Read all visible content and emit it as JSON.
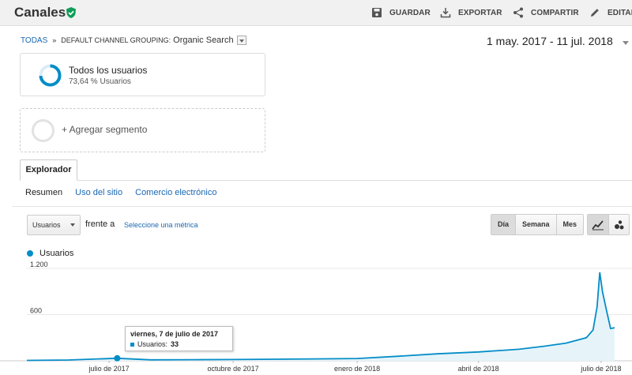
{
  "header": {
    "title": "Canales",
    "actions": [
      {
        "label": "GUARDAR",
        "icon": "save-icon"
      },
      {
        "label": "EXPORTAR",
        "icon": "export-icon"
      },
      {
        "label": "COMPARTIR",
        "icon": "share-icon"
      },
      {
        "label": "EDITAR",
        "icon": "pencil-icon"
      }
    ]
  },
  "breadcrumb": {
    "root": "TODAS",
    "separator": "»",
    "grouping": "DEFAULT CHANNEL GROUPING:",
    "value": "Organic Search"
  },
  "date_range": "1 may. 2017 - 11 jul. 2018",
  "segments": {
    "active": {
      "name": "Todos los usuarios",
      "percent": "73,64 % Usuarios",
      "percent_value": 73.64
    },
    "add_label": "+ Agregar segmento"
  },
  "tabs": {
    "main": "Explorador",
    "sub": [
      "Resumen",
      "Uso del sitio",
      "Comercio electrónico"
    ]
  },
  "controls": {
    "metric": "Usuarios",
    "versus": "frente a",
    "select_metric": "Seleccione una métrica",
    "granularity": [
      "Día",
      "Semana",
      "Mes"
    ],
    "granularity_selected": "Día"
  },
  "colors": {
    "series": "#058dc7",
    "link": "#1a67b3",
    "verified": "#0f9d58"
  },
  "tooltip": {
    "date": "viernes, 7 de julio de 2017",
    "label": "Usuarios:",
    "value": "33"
  },
  "chart_data": {
    "type": "line",
    "series_name": "Usuarios",
    "y_ticks": [
      "1.200",
      "600"
    ],
    "ylim": [
      0,
      1200
    ],
    "x_labels": [
      "julio de 2017",
      "octubre de 2017",
      "enero de 2018",
      "abril de 2018",
      "julio de 2018"
    ],
    "x_label_dates": [
      "2017-07-01",
      "2017-10-01",
      "2018-01-01",
      "2018-04-01",
      "2018-07-01"
    ],
    "date_range": [
      "2017-05-01",
      "2018-07-11"
    ],
    "highlight": {
      "date": "2017-07-07",
      "value": 33
    },
    "points": [
      [
        "2017-05-01",
        5
      ],
      [
        "2017-06-01",
        10
      ],
      [
        "2017-07-07",
        33
      ],
      [
        "2017-08-01",
        12
      ],
      [
        "2017-09-01",
        14
      ],
      [
        "2017-10-01",
        16
      ],
      [
        "2017-11-01",
        20
      ],
      [
        "2017-12-01",
        25
      ],
      [
        "2018-01-01",
        30
      ],
      [
        "2018-02-01",
        60
      ],
      [
        "2018-03-01",
        90
      ],
      [
        "2018-04-01",
        115
      ],
      [
        "2018-05-01",
        150
      ],
      [
        "2018-05-20",
        190
      ],
      [
        "2018-06-05",
        230
      ],
      [
        "2018-06-20",
        300
      ],
      [
        "2018-06-25",
        400
      ],
      [
        "2018-06-28",
        700
      ],
      [
        "2018-06-30",
        1150
      ],
      [
        "2018-07-02",
        900
      ],
      [
        "2018-07-05",
        650
      ],
      [
        "2018-07-08",
        420
      ],
      [
        "2018-07-11",
        430
      ]
    ]
  }
}
